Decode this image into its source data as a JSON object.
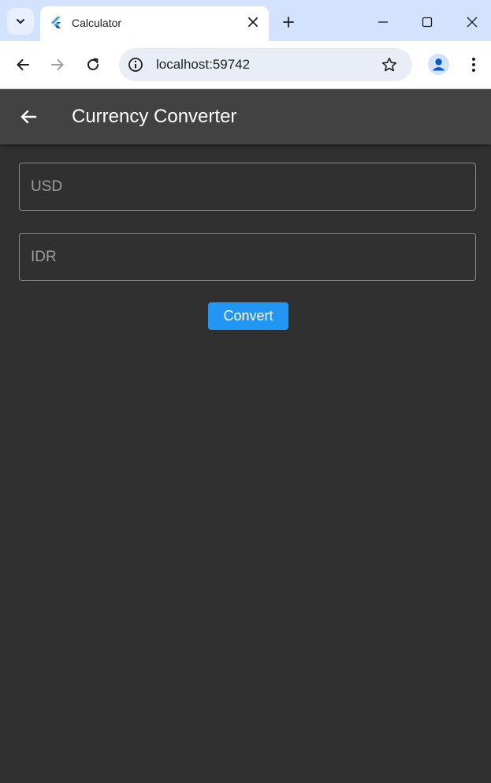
{
  "browser": {
    "tab_title": "Calculator",
    "url": "localhost:59742",
    "icons": {
      "tab_search": "chevron-down-icon",
      "favicon": "flutter-icon",
      "tab_close": "close-icon",
      "new_tab": "plus-icon",
      "minimize": "minimize-icon",
      "maximize": "maximize-icon",
      "window_close": "close-icon",
      "back": "arrow-left-icon",
      "forward": "arrow-right-icon",
      "reload": "reload-icon",
      "site_info": "info-icon",
      "bookmark": "star-icon",
      "profile": "person-icon",
      "menu": "more-vert-icon"
    },
    "colors": {
      "tabstrip": "#d3e3fd",
      "toolbar": "#ffffff",
      "omnibox": "#e9eef6"
    }
  },
  "app": {
    "title": "Currency Converter",
    "back_icon": "arrow-back-icon",
    "usd_field": {
      "placeholder": "USD",
      "value": ""
    },
    "idr_field": {
      "placeholder": "IDR",
      "value": ""
    },
    "convert_label": "Convert",
    "colors": {
      "background": "#303030",
      "appbar": "#424242",
      "accent": "#2196f3"
    }
  }
}
